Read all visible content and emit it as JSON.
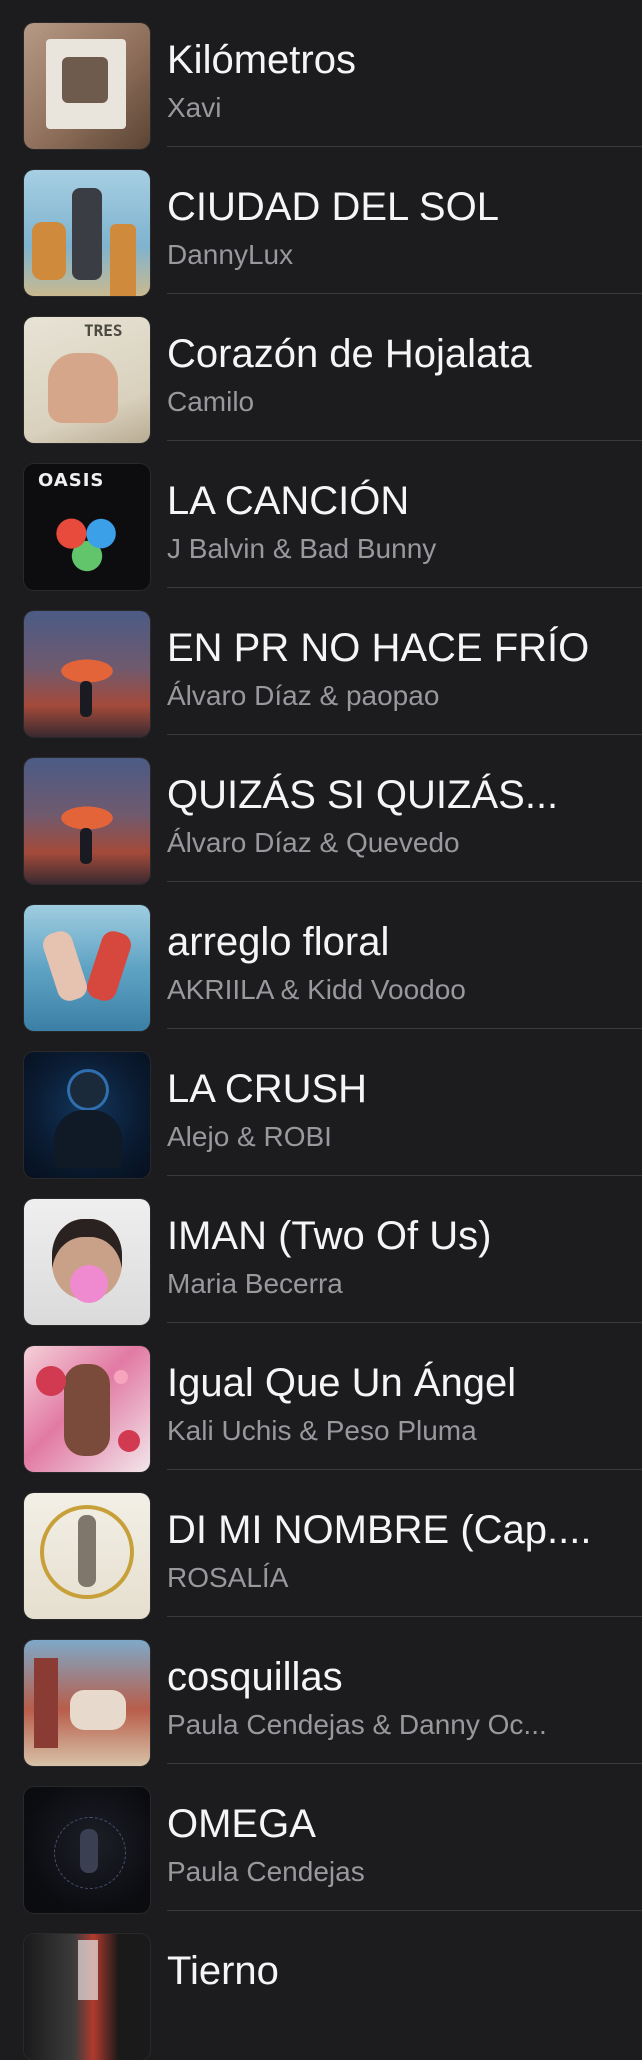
{
  "songs": [
    {
      "title": "Kilómetros",
      "artist": "Xavi",
      "artwork": "album-artwork-kilometros"
    },
    {
      "title": "CIUDAD DEL SOL",
      "artist": "DannyLux",
      "artwork": "album-artwork-ciudad-del-sol"
    },
    {
      "title": "Corazón de Hojalata",
      "artist": "Camilo",
      "artwork": "album-artwork-tres"
    },
    {
      "title": "LA CANCIÓN",
      "artist": "J Balvin & Bad Bunny",
      "artwork": "album-artwork-oasis"
    },
    {
      "title": "EN PR NO HACE FRÍO",
      "artist": "Álvaro Díaz & paopao",
      "artwork": "album-artwork-alvaro-diaz"
    },
    {
      "title": "QUIZÁS SI QUIZÁS...",
      "artist": "Álvaro Díaz & Quevedo",
      "artwork": "album-artwork-alvaro-diaz"
    },
    {
      "title": "arreglo floral",
      "artist": "AKRIILA & Kidd Voodoo",
      "artwork": "album-artwork-arreglo-floral"
    },
    {
      "title": "LA CRUSH",
      "artist": "Alejo & ROBI",
      "artwork": "album-artwork-la-crush"
    },
    {
      "title": "IMAN (Two Of Us)",
      "artist": "Maria Becerra",
      "artwork": "album-artwork-maria-becerra"
    },
    {
      "title": "Igual Que Un Ángel",
      "artist": "Kali Uchis & Peso Pluma",
      "artwork": "album-artwork-kali-uchis"
    },
    {
      "title": "DI MI NOMBRE (Cap....",
      "artist": "ROSALÍA",
      "artwork": "album-artwork-rosalia"
    },
    {
      "title": "cosquillas",
      "artist": "Paula Cendejas & Danny Oc...",
      "artwork": "album-artwork-cosquillas"
    },
    {
      "title": "OMEGA",
      "artist": "Paula Cendejas",
      "artwork": "album-artwork-omega"
    },
    {
      "title": "Tierno",
      "artist": "",
      "artwork": "album-artwork-tierno"
    }
  ]
}
